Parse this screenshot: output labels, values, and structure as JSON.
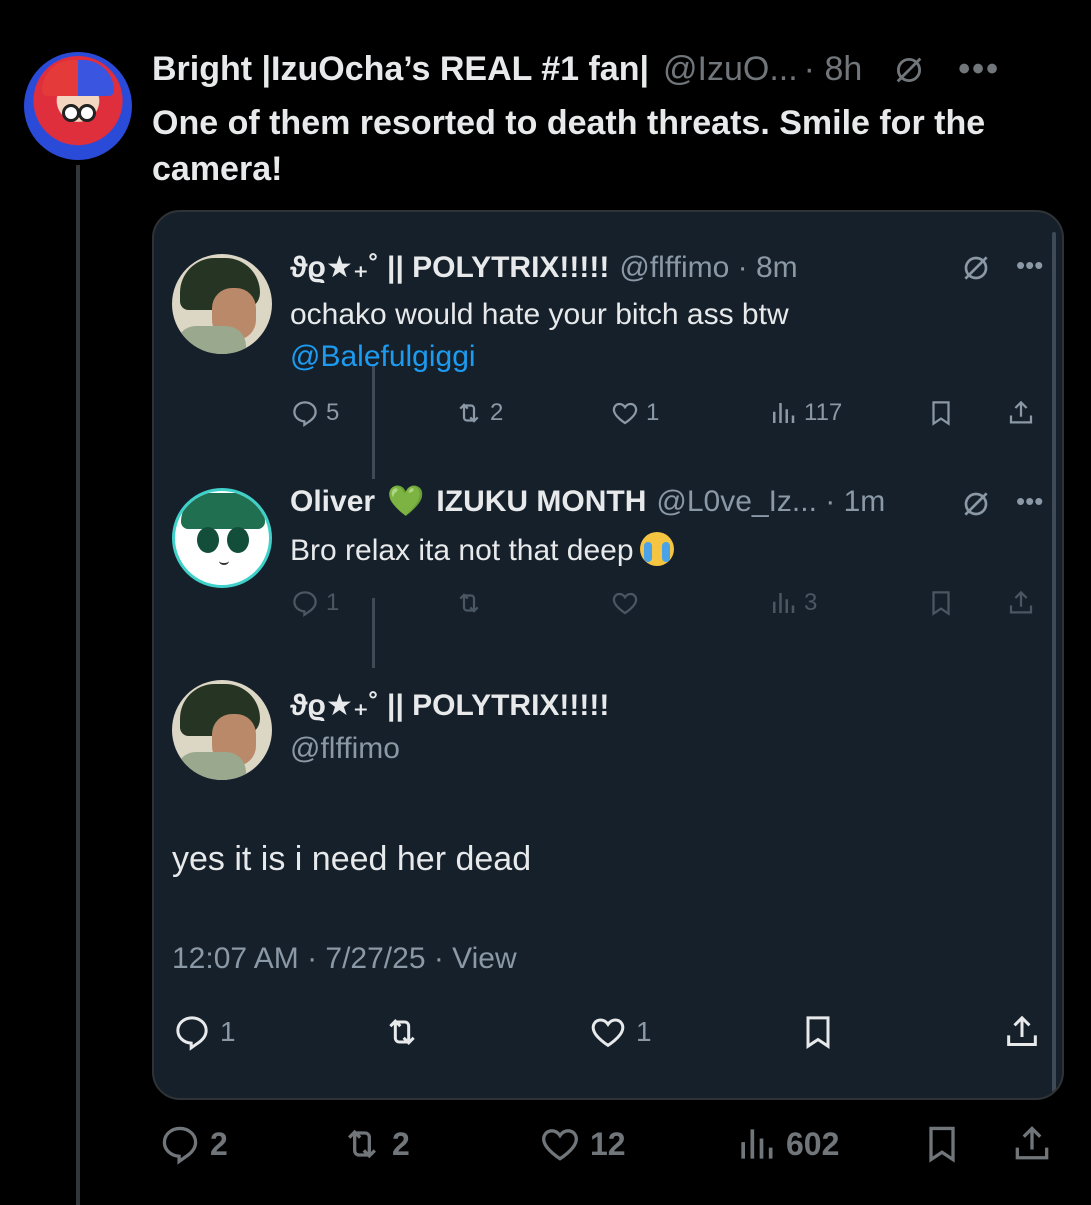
{
  "post": {
    "name": "Bright |IzuOcha’s REAL #1 fan|",
    "handle": "@IzuO...",
    "time": "· 8h",
    "text": "One of them resorted to death threats. Smile for the camera!",
    "stats": {
      "replies": "2",
      "reposts": "2",
      "likes": "12",
      "views": "602"
    }
  },
  "quote": {
    "tweet1": {
      "name": "ϑϱ★₊˚ || POLYTRIX!!!!!",
      "handle": "@flffimo · 8m",
      "text": "ochako would hate your bitch ass btw",
      "mention": "@Balefulgiggi",
      "replies": "5",
      "reposts": "2",
      "likes": "1",
      "views": "117"
    },
    "tweet2": {
      "name": "Oliver",
      "badge": "💚",
      "name2": "IZUKU MONTH",
      "handle": "@L0ve_Iz... · 1m",
      "text": "Bro relax ita not that deep",
      "replies": "1",
      "views": "3"
    },
    "tweet3": {
      "name": "ϑϱ★₊˚ || POLYTRIX!!!!!",
      "handle": "@flffimo",
      "text": "yes it is i need her dead",
      "meta": "12:07 AM · 7/27/25 · View",
      "replies": "1",
      "likes": "1"
    }
  },
  "icons": [
    "grok-icon",
    "more-icon",
    "reply-icon",
    "repost-icon",
    "like-icon",
    "views-icon",
    "bookmark-icon",
    "share-icon"
  ],
  "colors": {
    "background": "#000000",
    "card": "#15202b",
    "link": "#1d9bf0",
    "muted": "#71767b"
  }
}
